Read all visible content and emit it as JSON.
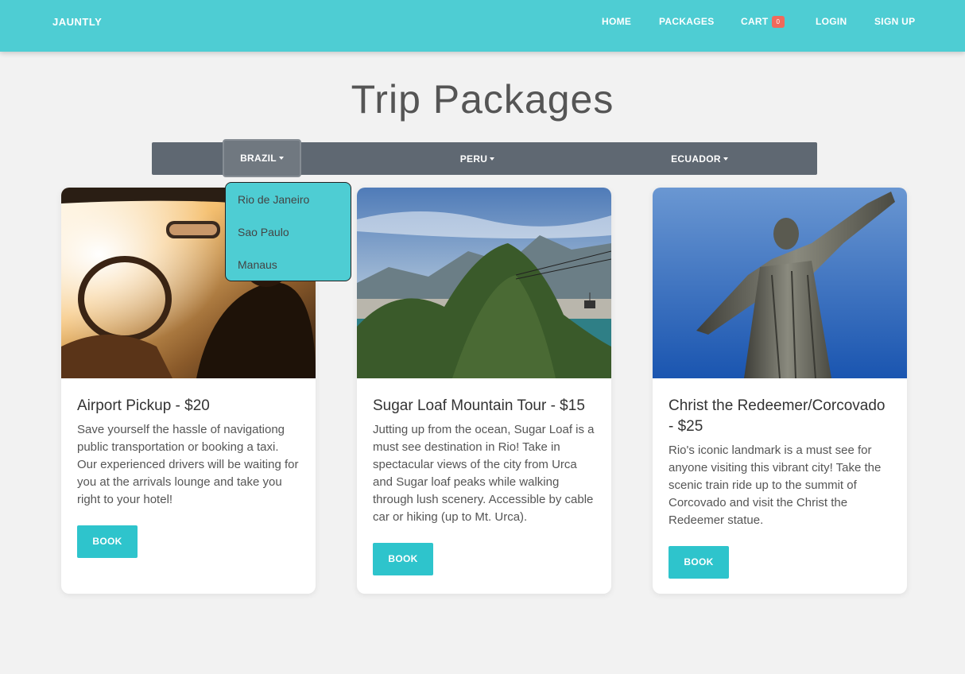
{
  "navbar": {
    "brand": "JAUNTLY",
    "links": {
      "home": "HOME",
      "packages": "PACKAGES",
      "cart": "CART",
      "cart_count": "0",
      "login": "LOGIN",
      "signup": "SIGN UP"
    }
  },
  "page_title": "Trip Packages",
  "filters": {
    "tabs": [
      "BRAZIL",
      "PERU",
      "ECUADOR"
    ],
    "active": "BRAZIL",
    "dropdown_items": [
      "Rio de Janeiro",
      "Sao Paulo",
      "Manaus"
    ]
  },
  "cards": [
    {
      "title": "Airport Pickup - $20",
      "text": "Save yourself the hassle of navigationg public transportation or booking a taxi. Our experienced drivers will be waiting for you at the arrivals lounge and take you right to your hotel!",
      "button": "BOOK",
      "image_icon": "car-interior-image"
    },
    {
      "title": "Sugar Loaf Mountain Tour - $15",
      "text": "Jutting up from the ocean, Sugar Loaf is a must see destination in Rio! Take in spectacular views of the city from Urca and Sugar loaf peaks while walking through lush scenery. Accessible by cable car or hiking (up to Mt. Urca).",
      "button": "BOOK",
      "image_icon": "mountain-view-image"
    },
    {
      "title": "Christ the Redeemer/Corcovado - $25",
      "text": "Rio's iconic landmark is a must see for anyone visiting this vibrant city! Take the scenic train ride up to the summit of Corcovado and visit the Christ the Redeemer statue.",
      "button": "BOOK",
      "image_icon": "statue-image"
    }
  ],
  "colors": {
    "navbar": "#4ecdd3",
    "filter_bar": "#5f6872",
    "button": "#2ec4cc",
    "badge": "#f0695b",
    "background": "#f2f2f2"
  }
}
